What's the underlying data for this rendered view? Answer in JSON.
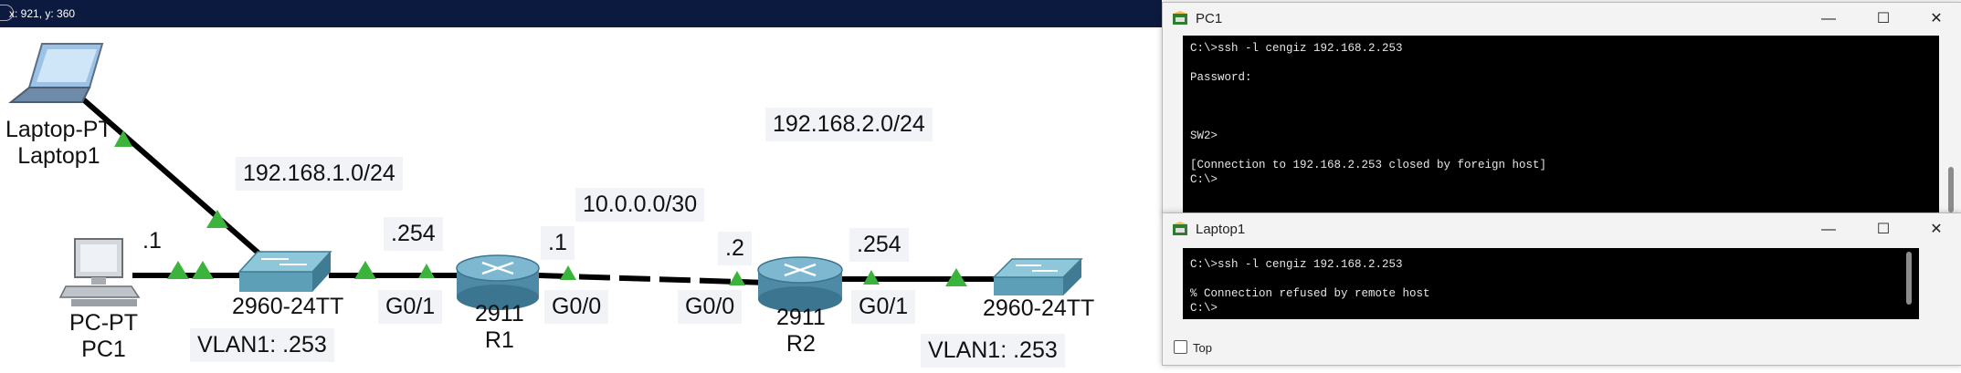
{
  "status_bar": {
    "coords": "x: 921, y: 360"
  },
  "topology": {
    "laptop": {
      "type": "Laptop-PT",
      "name": "Laptop1"
    },
    "pc": {
      "type": "PC-PT",
      "name": "PC1",
      "ip": ".1"
    },
    "switch1": {
      "model": "2960-24TT",
      "vlan": "VLAN1: .253"
    },
    "switch2": {
      "model": "2960-24TT",
      "vlan": "VLAN1: .253"
    },
    "r1": {
      "model": "2911",
      "name": "R1",
      "g01_ip": ".254",
      "g01": "G0/1",
      "g00_ip": ".1",
      "g00": "G0/0"
    },
    "r2": {
      "model": "2911",
      "name": "R2",
      "g00_ip": ".2",
      "g00": "G0/0",
      "g01_ip": ".254",
      "g01": "G0/1"
    },
    "net_lan1": "192.168.1.0/24",
    "net_wan": "10.0.0.0/30",
    "net_lan2": "192.168.2.0/24"
  },
  "pc1_window": {
    "title": "PC1",
    "lines": [
      "C:\\>ssh -l cengiz 192.168.2.253",
      "",
      "Password:",
      "",
      "",
      "",
      "SW2>",
      "",
      "[Connection to 192.168.2.253 closed by foreign host]",
      "C:\\>"
    ]
  },
  "laptop1_window": {
    "title": "Laptop1",
    "lines": [
      "C:\\>ssh -l cengiz 192.168.2.253",
      "",
      "% Connection refused by remote host",
      "C:\\>"
    ],
    "top_label": "Top"
  },
  "colors": {
    "link": "#000000",
    "port_up": "#3cb33c",
    "topbar": "#0c1a40"
  }
}
